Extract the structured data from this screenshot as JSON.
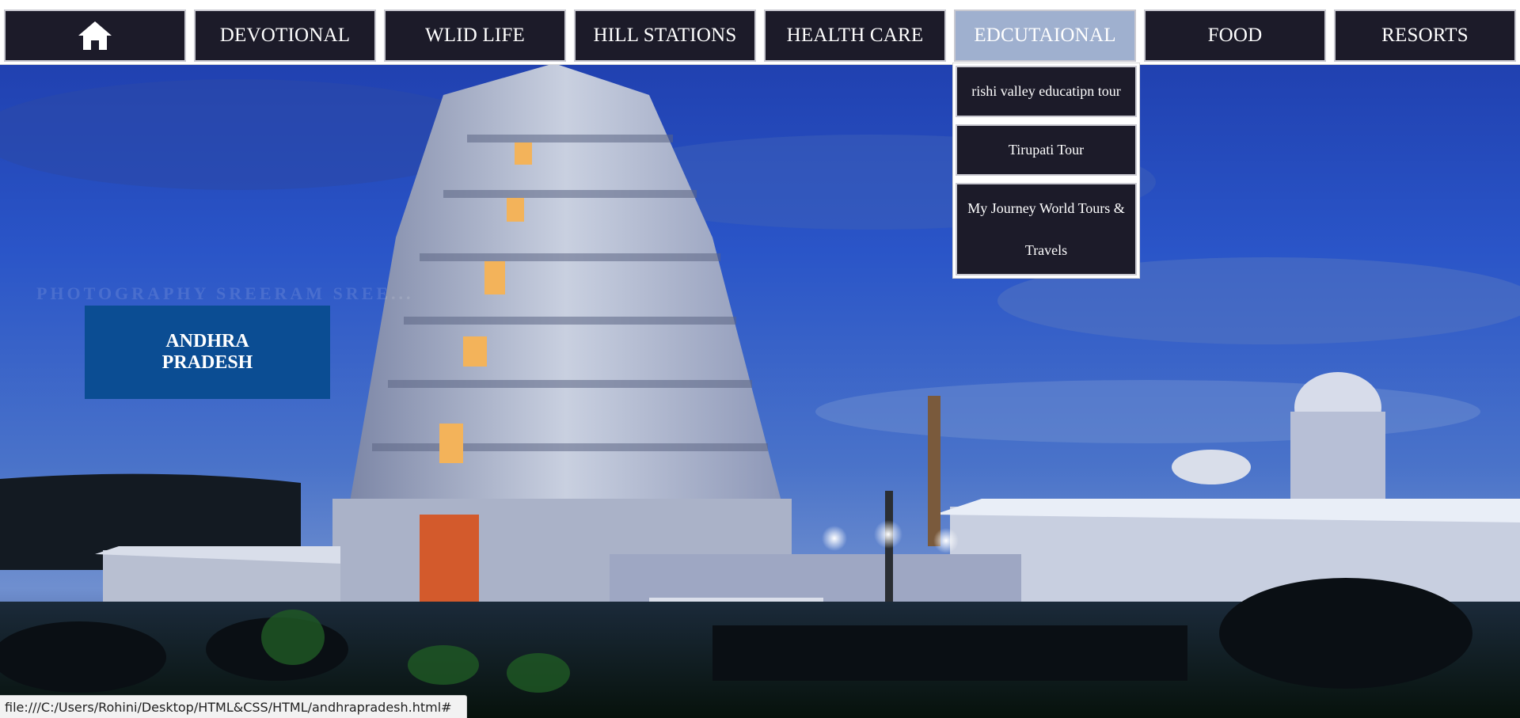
{
  "colors": {
    "nav_bg": "#1c1b29",
    "nav_active_bg": "#9fb0cf",
    "nav_border": "#c9c9d1",
    "state_card_bg": "#0b4d93",
    "text_on_dark": "#ffffff"
  },
  "nav": {
    "home_icon": "home-icon",
    "items": [
      {
        "label": "DEVOTIONAL"
      },
      {
        "label": "WLID LIFE"
      },
      {
        "label": "HILL STATIONS"
      },
      {
        "label": "HEALTH CARE"
      },
      {
        "label": "EDCUTAIONAL",
        "active": true
      },
      {
        "label": "FOOD"
      },
      {
        "label": "RESORTS"
      }
    ]
  },
  "dropdown": {
    "parent": "EDCUTAIONAL",
    "items": [
      {
        "label": "rishi valley educatipn tour"
      },
      {
        "label": "Tirupati Tour"
      },
      {
        "label": "My Journey World Tours & Travels"
      }
    ]
  },
  "hero": {
    "state_card": "ANDHRA PRADESH",
    "watermark": "PHOTOGRAPHY SREERAM SREE..."
  },
  "statusbar": {
    "url": "file:///C:/Users/Rohini/Desktop/HTML&CSS/HTML/andhrapradesh.html#"
  }
}
